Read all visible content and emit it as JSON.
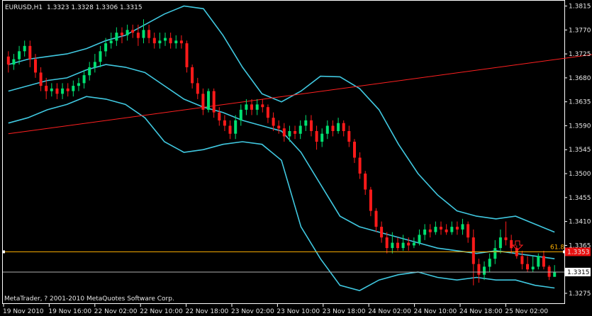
{
  "header": {
    "symbol_tf": "EURUSD,H1",
    "ohlc": "1.3323 1.3328 1.3306 1.3315"
  },
  "footer": {
    "copyright": "MetaTrader, ? 2001-2010 MetaQuotes Software Corp."
  },
  "colors": {
    "background": "#000000",
    "frame": "#ffffff",
    "bull": "#00e070",
    "bear": "#ff1a1a",
    "bands": "#40c8e0",
    "trendline": "#ff2020",
    "fib_line": "#ffb000",
    "bid_line": "#b0b0b0",
    "text": "#e8e8e8"
  },
  "arrow_icon": "down-arrow-icon",
  "chart_data": {
    "type": "candlestick",
    "symbol": "EURUSD",
    "timeframe": "H1",
    "ylim": [
      1.3255,
      1.3825
    ],
    "price_axis_ticks": [
      "1.3815",
      "1.3770",
      "1.3725",
      "1.3680",
      "1.3635",
      "1.3590",
      "1.3545",
      "1.3500",
      "1.3455",
      "1.3410",
      "1.3365",
      "1.3275"
    ],
    "time_axis_ticks": [
      "19 Nov 2010",
      "19 Nov 16:00",
      "22 Nov 02:00",
      "22 Nov 10:00",
      "22 Nov 18:00",
      "23 Nov 02:00",
      "23 Nov 10:00",
      "23 Nov 18:00",
      "24 Nov 02:00",
      "24 Nov 10:00",
      "24 Nov 18:00",
      "25 Nov 02:00"
    ],
    "current_price": "1.3315",
    "fib_level": {
      "label": "61.8",
      "price": 1.3353,
      "marker": "1.3353"
    },
    "trendline": {
      "from": [
        0,
        1.3575
      ],
      "to": [
        140,
        1.3768
      ]
    },
    "candles": [
      [
        1.372,
        1.3705,
        1.373,
        1.369
      ],
      [
        1.3705,
        1.3715,
        1.3725,
        1.3695
      ],
      [
        1.3715,
        1.373,
        1.374,
        1.3705
      ],
      [
        1.373,
        1.374,
        1.375,
        1.372
      ],
      [
        1.374,
        1.3715,
        1.375,
        1.37
      ],
      [
        1.3715,
        1.369,
        1.3725,
        1.368
      ],
      [
        1.369,
        1.3665,
        1.37,
        1.3655
      ],
      [
        1.3665,
        1.3655,
        1.368,
        1.364
      ],
      [
        1.3655,
        1.366,
        1.367,
        1.3645
      ],
      [
        1.366,
        1.365,
        1.367,
        1.364
      ],
      [
        1.365,
        1.366,
        1.367,
        1.364
      ],
      [
        1.366,
        1.3655,
        1.367,
        1.3645
      ],
      [
        1.3655,
        1.3665,
        1.3675,
        1.3645
      ],
      [
        1.3665,
        1.367,
        1.368,
        1.3655
      ],
      [
        1.367,
        1.3685,
        1.3695,
        1.366
      ],
      [
        1.3685,
        1.37,
        1.371,
        1.3675
      ],
      [
        1.37,
        1.371,
        1.3725,
        1.369
      ],
      [
        1.371,
        1.373,
        1.374,
        1.37
      ],
      [
        1.373,
        1.3745,
        1.3755,
        1.372
      ],
      [
        1.3745,
        1.375,
        1.3765,
        1.3735
      ],
      [
        1.375,
        1.3765,
        1.3775,
        1.374
      ],
      [
        1.3765,
        1.376,
        1.3775,
        1.3745
      ],
      [
        1.376,
        1.377,
        1.378,
        1.375
      ],
      [
        1.377,
        1.3765,
        1.378,
        1.3755
      ],
      [
        1.3765,
        1.3755,
        1.378,
        1.374
      ],
      [
        1.3755,
        1.377,
        1.379,
        1.3745
      ],
      [
        1.377,
        1.3755,
        1.378,
        1.3745
      ],
      [
        1.3755,
        1.3745,
        1.3765,
        1.3735
      ],
      [
        1.3745,
        1.375,
        1.3765,
        1.3735
      ],
      [
        1.375,
        1.3755,
        1.3765,
        1.374
      ],
      [
        1.3755,
        1.3745,
        1.3765,
        1.3735
      ],
      [
        1.3745,
        1.375,
        1.376,
        1.3735
      ],
      [
        1.375,
        1.3745,
        1.376,
        1.3735
      ],
      [
        1.3745,
        1.37,
        1.375,
        1.369
      ],
      [
        1.37,
        1.367,
        1.3705,
        1.366
      ],
      [
        1.367,
        1.365,
        1.368,
        1.364
      ],
      [
        1.365,
        1.362,
        1.366,
        1.361
      ],
      [
        1.362,
        1.3655,
        1.366,
        1.3615
      ],
      [
        1.3655,
        1.3615,
        1.366,
        1.3605
      ],
      [
        1.3615,
        1.36,
        1.3625,
        1.359
      ],
      [
        1.36,
        1.359,
        1.361,
        1.358
      ],
      [
        1.359,
        1.3575,
        1.36,
        1.3565
      ],
      [
        1.3575,
        1.36,
        1.361,
        1.3565
      ],
      [
        1.36,
        1.362,
        1.363,
        1.359
      ],
      [
        1.362,
        1.363,
        1.364,
        1.361
      ],
      [
        1.363,
        1.362,
        1.364,
        1.361
      ],
      [
        1.362,
        1.363,
        1.364,
        1.361
      ],
      [
        1.363,
        1.3625,
        1.364,
        1.3615
      ],
      [
        1.3625,
        1.3605,
        1.363,
        1.3595
      ],
      [
        1.3605,
        1.359,
        1.3615,
        1.358
      ],
      [
        1.359,
        1.3585,
        1.36,
        1.3575
      ],
      [
        1.3585,
        1.357,
        1.3595,
        1.356
      ],
      [
        1.357,
        1.358,
        1.359,
        1.356
      ],
      [
        1.358,
        1.3575,
        1.359,
        1.3565
      ],
      [
        1.3575,
        1.359,
        1.36,
        1.3565
      ],
      [
        1.359,
        1.36,
        1.361,
        1.358
      ],
      [
        1.36,
        1.358,
        1.361,
        1.357
      ],
      [
        1.358,
        1.356,
        1.359,
        1.3545
      ],
      [
        1.356,
        1.3575,
        1.3585,
        1.355
      ],
      [
        1.3575,
        1.359,
        1.36,
        1.3565
      ],
      [
        1.359,
        1.358,
        1.36,
        1.357
      ],
      [
        1.358,
        1.3595,
        1.3605,
        1.3575
      ],
      [
        1.3595,
        1.358,
        1.36,
        1.357
      ],
      [
        1.358,
        1.356,
        1.359,
        1.355
      ],
      [
        1.356,
        1.353,
        1.3565,
        1.352
      ],
      [
        1.353,
        1.35,
        1.354,
        1.349
      ],
      [
        1.35,
        1.347,
        1.3505,
        1.346
      ],
      [
        1.347,
        1.343,
        1.3475,
        1.342
      ],
      [
        1.343,
        1.34,
        1.3435,
        1.339
      ],
      [
        1.34,
        1.338,
        1.341,
        1.337
      ],
      [
        1.338,
        1.336,
        1.339,
        1.335
      ],
      [
        1.336,
        1.337,
        1.339,
        1.335
      ],
      [
        1.337,
        1.336,
        1.338,
        1.3355
      ],
      [
        1.336,
        1.337,
        1.3385,
        1.3355
      ],
      [
        1.337,
        1.3365,
        1.338,
        1.3355
      ],
      [
        1.3365,
        1.337,
        1.338,
        1.336
      ],
      [
        1.337,
        1.3385,
        1.3395,
        1.3365
      ],
      [
        1.3385,
        1.3395,
        1.3405,
        1.3375
      ],
      [
        1.3395,
        1.339,
        1.3405,
        1.338
      ],
      [
        1.339,
        1.34,
        1.341,
        1.3385
      ],
      [
        1.34,
        1.3395,
        1.341,
        1.3385
      ],
      [
        1.3395,
        1.339,
        1.3405,
        1.3385
      ],
      [
        1.339,
        1.34,
        1.341,
        1.3385
      ],
      [
        1.34,
        1.3395,
        1.341,
        1.3385
      ],
      [
        1.3395,
        1.3405,
        1.3415,
        1.3385
      ],
      [
        1.3405,
        1.338,
        1.341,
        1.337
      ],
      [
        1.338,
        1.333,
        1.3395,
        1.329
      ],
      [
        1.333,
        1.331,
        1.334,
        1.3295
      ],
      [
        1.331,
        1.3325,
        1.3335,
        1.33
      ],
      [
        1.3325,
        1.334,
        1.335,
        1.3315
      ],
      [
        1.334,
        1.336,
        1.3375,
        1.333
      ],
      [
        1.336,
        1.338,
        1.3395,
        1.335
      ],
      [
        1.338,
        1.3375,
        1.341,
        1.3365
      ],
      [
        1.3375,
        1.336,
        1.3385,
        1.335
      ],
      [
        1.336,
        1.3345,
        1.3365,
        1.334
      ],
      [
        1.3345,
        1.333,
        1.3355,
        1.332
      ],
      [
        1.333,
        1.332,
        1.3345,
        1.3315
      ],
      [
        1.332,
        1.3325,
        1.3345,
        1.3315
      ],
      [
        1.3325,
        1.3345,
        1.335,
        1.332
      ],
      [
        1.3345,
        1.3325,
        1.3355,
        1.332
      ],
      [
        1.3325,
        1.3306,
        1.3328,
        1.33
      ],
      [
        1.3306,
        1.3315,
        1.3328,
        1.3306
      ]
    ],
    "bands": {
      "upper": [
        1.3705,
        1.3715,
        1.372,
        1.3725,
        1.3735,
        1.375,
        1.376,
        1.378,
        1.38,
        1.3815,
        1.381,
        1.376,
        1.37,
        1.365,
        1.3635,
        1.3655,
        1.3683,
        1.3682,
        1.366,
        1.362,
        1.3555,
        1.35,
        1.346,
        1.343,
        1.342,
        1.3415,
        1.342,
        1.3405,
        1.339
      ],
      "middle": [
        1.3655,
        1.3665,
        1.3675,
        1.368,
        1.3695,
        1.3705,
        1.37,
        1.369,
        1.3665,
        1.364,
        1.3625,
        1.3615,
        1.36,
        1.359,
        1.358,
        1.354,
        1.348,
        1.342,
        1.34,
        1.339,
        1.338,
        1.337,
        1.336,
        1.3355,
        1.335,
        1.3355,
        1.335,
        1.3345,
        1.334
      ],
      "lower": [
        1.3595,
        1.3605,
        1.362,
        1.363,
        1.3645,
        1.364,
        1.363,
        1.3605,
        1.356,
        1.354,
        1.3545,
        1.3555,
        1.356,
        1.3555,
        1.3525,
        1.34,
        1.334,
        1.329,
        1.328,
        1.33,
        1.331,
        1.3315,
        1.3305,
        1.33,
        1.3305,
        1.33,
        1.33,
        1.329,
        1.3285
      ]
    }
  }
}
